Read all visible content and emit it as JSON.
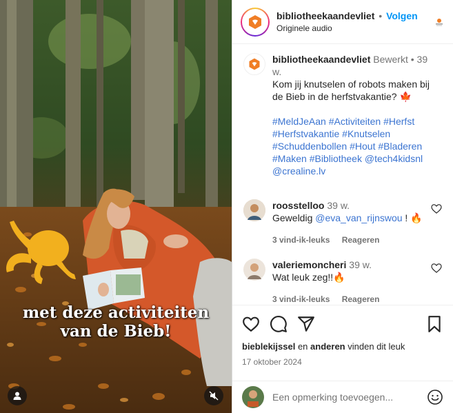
{
  "header": {
    "username": "bibliotheekaandevliet",
    "separator": "•",
    "follow_label": "Volgen",
    "audio": "Originele audio"
  },
  "caption": {
    "username": "bibliotheekaandevliet",
    "edited": "Bewerkt",
    "separator": "•",
    "age": "39 w.",
    "text": "Kom jij knutselen of robots maken bij de Bieb in de herfstvakantie? 🍁",
    "tags_line1": "#MeldJeAan #Activiteiten #Herfst",
    "tags_line2": "#Herfstvakantie #Knutselen",
    "tags_line3": "#Schuddenbollen #Hout #Bladeren",
    "tags_line4": "#Maken #Bibliotheek @tech4kidsnl",
    "tags_line5": "@crealine.lv"
  },
  "comments": [
    {
      "username": "roosstelloo",
      "age": "39 w.",
      "text_before": "Geweldig ",
      "mention": "@eva_van_rijnswou",
      "text_after": " ! 🔥",
      "likes": "3 vind-ik-leuks",
      "reply": "Reageren"
    },
    {
      "username": "valeriemoncheri",
      "age": "39 w.",
      "text": "Wat leuk zeg!!🔥",
      "likes": "3 vind-ik-leuks",
      "reply": "Reageren"
    }
  ],
  "media": {
    "overlay_line1": "met deze activiteiten",
    "overlay_line2": "van de Bieb!"
  },
  "likes": {
    "user": "bieblekijssel",
    "and": "en",
    "others": "anderen",
    "suffix": "vinden dit leuk"
  },
  "date": "17 oktober 2024",
  "add_comment": {
    "placeholder": "Een opmerking toevoegen..."
  },
  "colors": {
    "brand_orange": "#f07e26",
    "follow_blue": "#0095f6",
    "link_blue": "#3b74d1"
  }
}
